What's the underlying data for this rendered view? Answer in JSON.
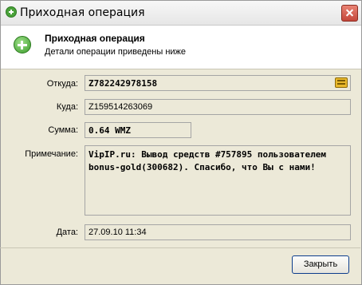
{
  "window": {
    "title": "Приходная операция",
    "close_label": "×"
  },
  "header": {
    "title": "Приходная операция",
    "subtitle": "Детали операции приведены ниже"
  },
  "form": {
    "from_label": "Откуда:",
    "from_value": "Z782242978158",
    "to_label": "Куда:",
    "to_value": "Z159514263069",
    "amount_label": "Сумма:",
    "amount_value": "0.64 WMZ",
    "note_label": "Примечание:",
    "note_value": "VipIP.ru: Вывод средств #757895 пользователем bonus-gold(300682). Спасибо, что Вы с нами!",
    "date_label": "Дата:",
    "date_value": "27.09.10 11:34"
  },
  "buttons": {
    "close": "Закрыть"
  }
}
